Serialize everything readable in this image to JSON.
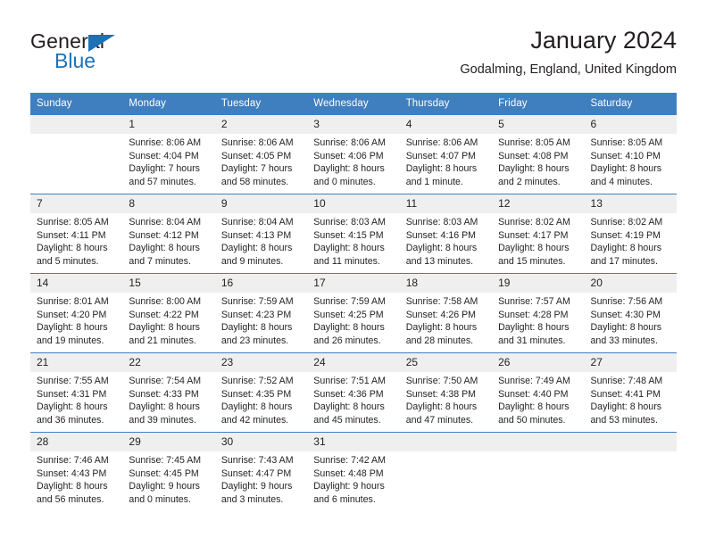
{
  "brand": {
    "name_part1": "General",
    "name_part2": "Blue",
    "triangle_color": "#1b72b8"
  },
  "header": {
    "title": "January 2024",
    "subtitle": "Godalming, England, United Kingdom"
  },
  "calendar": {
    "header_bg": "#3f7fbf",
    "daynum_bg": "#efefef",
    "weekdays": [
      "Sunday",
      "Monday",
      "Tuesday",
      "Wednesday",
      "Thursday",
      "Friday",
      "Saturday"
    ],
    "weeks": [
      [
        {
          "day": "",
          "sunrise": "",
          "sunset": "",
          "daylight": "",
          "empty": true
        },
        {
          "day": "1",
          "sunrise": "Sunrise: 8:06 AM",
          "sunset": "Sunset: 4:04 PM",
          "daylight": "Daylight: 7 hours and 57 minutes."
        },
        {
          "day": "2",
          "sunrise": "Sunrise: 8:06 AM",
          "sunset": "Sunset: 4:05 PM",
          "daylight": "Daylight: 7 hours and 58 minutes."
        },
        {
          "day": "3",
          "sunrise": "Sunrise: 8:06 AM",
          "sunset": "Sunset: 4:06 PM",
          "daylight": "Daylight: 8 hours and 0 minutes."
        },
        {
          "day": "4",
          "sunrise": "Sunrise: 8:06 AM",
          "sunset": "Sunset: 4:07 PM",
          "daylight": "Daylight: 8 hours and 1 minute."
        },
        {
          "day": "5",
          "sunrise": "Sunrise: 8:05 AM",
          "sunset": "Sunset: 4:08 PM",
          "daylight": "Daylight: 8 hours and 2 minutes."
        },
        {
          "day": "6",
          "sunrise": "Sunrise: 8:05 AM",
          "sunset": "Sunset: 4:10 PM",
          "daylight": "Daylight: 8 hours and 4 minutes."
        }
      ],
      [
        {
          "day": "7",
          "sunrise": "Sunrise: 8:05 AM",
          "sunset": "Sunset: 4:11 PM",
          "daylight": "Daylight: 8 hours and 5 minutes."
        },
        {
          "day": "8",
          "sunrise": "Sunrise: 8:04 AM",
          "sunset": "Sunset: 4:12 PM",
          "daylight": "Daylight: 8 hours and 7 minutes."
        },
        {
          "day": "9",
          "sunrise": "Sunrise: 8:04 AM",
          "sunset": "Sunset: 4:13 PM",
          "daylight": "Daylight: 8 hours and 9 minutes."
        },
        {
          "day": "10",
          "sunrise": "Sunrise: 8:03 AM",
          "sunset": "Sunset: 4:15 PM",
          "daylight": "Daylight: 8 hours and 11 minutes."
        },
        {
          "day": "11",
          "sunrise": "Sunrise: 8:03 AM",
          "sunset": "Sunset: 4:16 PM",
          "daylight": "Daylight: 8 hours and 13 minutes."
        },
        {
          "day": "12",
          "sunrise": "Sunrise: 8:02 AM",
          "sunset": "Sunset: 4:17 PM",
          "daylight": "Daylight: 8 hours and 15 minutes."
        },
        {
          "day": "13",
          "sunrise": "Sunrise: 8:02 AM",
          "sunset": "Sunset: 4:19 PM",
          "daylight": "Daylight: 8 hours and 17 minutes."
        }
      ],
      [
        {
          "day": "14",
          "sunrise": "Sunrise: 8:01 AM",
          "sunset": "Sunset: 4:20 PM",
          "daylight": "Daylight: 8 hours and 19 minutes."
        },
        {
          "day": "15",
          "sunrise": "Sunrise: 8:00 AM",
          "sunset": "Sunset: 4:22 PM",
          "daylight": "Daylight: 8 hours and 21 minutes."
        },
        {
          "day": "16",
          "sunrise": "Sunrise: 7:59 AM",
          "sunset": "Sunset: 4:23 PM",
          "daylight": "Daylight: 8 hours and 23 minutes."
        },
        {
          "day": "17",
          "sunrise": "Sunrise: 7:59 AM",
          "sunset": "Sunset: 4:25 PM",
          "daylight": "Daylight: 8 hours and 26 minutes."
        },
        {
          "day": "18",
          "sunrise": "Sunrise: 7:58 AM",
          "sunset": "Sunset: 4:26 PM",
          "daylight": "Daylight: 8 hours and 28 minutes."
        },
        {
          "day": "19",
          "sunrise": "Sunrise: 7:57 AM",
          "sunset": "Sunset: 4:28 PM",
          "daylight": "Daylight: 8 hours and 31 minutes."
        },
        {
          "day": "20",
          "sunrise": "Sunrise: 7:56 AM",
          "sunset": "Sunset: 4:30 PM",
          "daylight": "Daylight: 8 hours and 33 minutes."
        }
      ],
      [
        {
          "day": "21",
          "sunrise": "Sunrise: 7:55 AM",
          "sunset": "Sunset: 4:31 PM",
          "daylight": "Daylight: 8 hours and 36 minutes."
        },
        {
          "day": "22",
          "sunrise": "Sunrise: 7:54 AM",
          "sunset": "Sunset: 4:33 PM",
          "daylight": "Daylight: 8 hours and 39 minutes."
        },
        {
          "day": "23",
          "sunrise": "Sunrise: 7:52 AM",
          "sunset": "Sunset: 4:35 PM",
          "daylight": "Daylight: 8 hours and 42 minutes."
        },
        {
          "day": "24",
          "sunrise": "Sunrise: 7:51 AM",
          "sunset": "Sunset: 4:36 PM",
          "daylight": "Daylight: 8 hours and 45 minutes."
        },
        {
          "day": "25",
          "sunrise": "Sunrise: 7:50 AM",
          "sunset": "Sunset: 4:38 PM",
          "daylight": "Daylight: 8 hours and 47 minutes."
        },
        {
          "day": "26",
          "sunrise": "Sunrise: 7:49 AM",
          "sunset": "Sunset: 4:40 PM",
          "daylight": "Daylight: 8 hours and 50 minutes."
        },
        {
          "day": "27",
          "sunrise": "Sunrise: 7:48 AM",
          "sunset": "Sunset: 4:41 PM",
          "daylight": "Daylight: 8 hours and 53 minutes."
        }
      ],
      [
        {
          "day": "28",
          "sunrise": "Sunrise: 7:46 AM",
          "sunset": "Sunset: 4:43 PM",
          "daylight": "Daylight: 8 hours and 56 minutes."
        },
        {
          "day": "29",
          "sunrise": "Sunrise: 7:45 AM",
          "sunset": "Sunset: 4:45 PM",
          "daylight": "Daylight: 9 hours and 0 minutes."
        },
        {
          "day": "30",
          "sunrise": "Sunrise: 7:43 AM",
          "sunset": "Sunset: 4:47 PM",
          "daylight": "Daylight: 9 hours and 3 minutes."
        },
        {
          "day": "31",
          "sunrise": "Sunrise: 7:42 AM",
          "sunset": "Sunset: 4:48 PM",
          "daylight": "Daylight: 9 hours and 6 minutes."
        },
        {
          "day": "",
          "sunrise": "",
          "sunset": "",
          "daylight": "",
          "empty": true
        },
        {
          "day": "",
          "sunrise": "",
          "sunset": "",
          "daylight": "",
          "empty": true
        },
        {
          "day": "",
          "sunrise": "",
          "sunset": "",
          "daylight": "",
          "empty": true
        }
      ]
    ]
  }
}
